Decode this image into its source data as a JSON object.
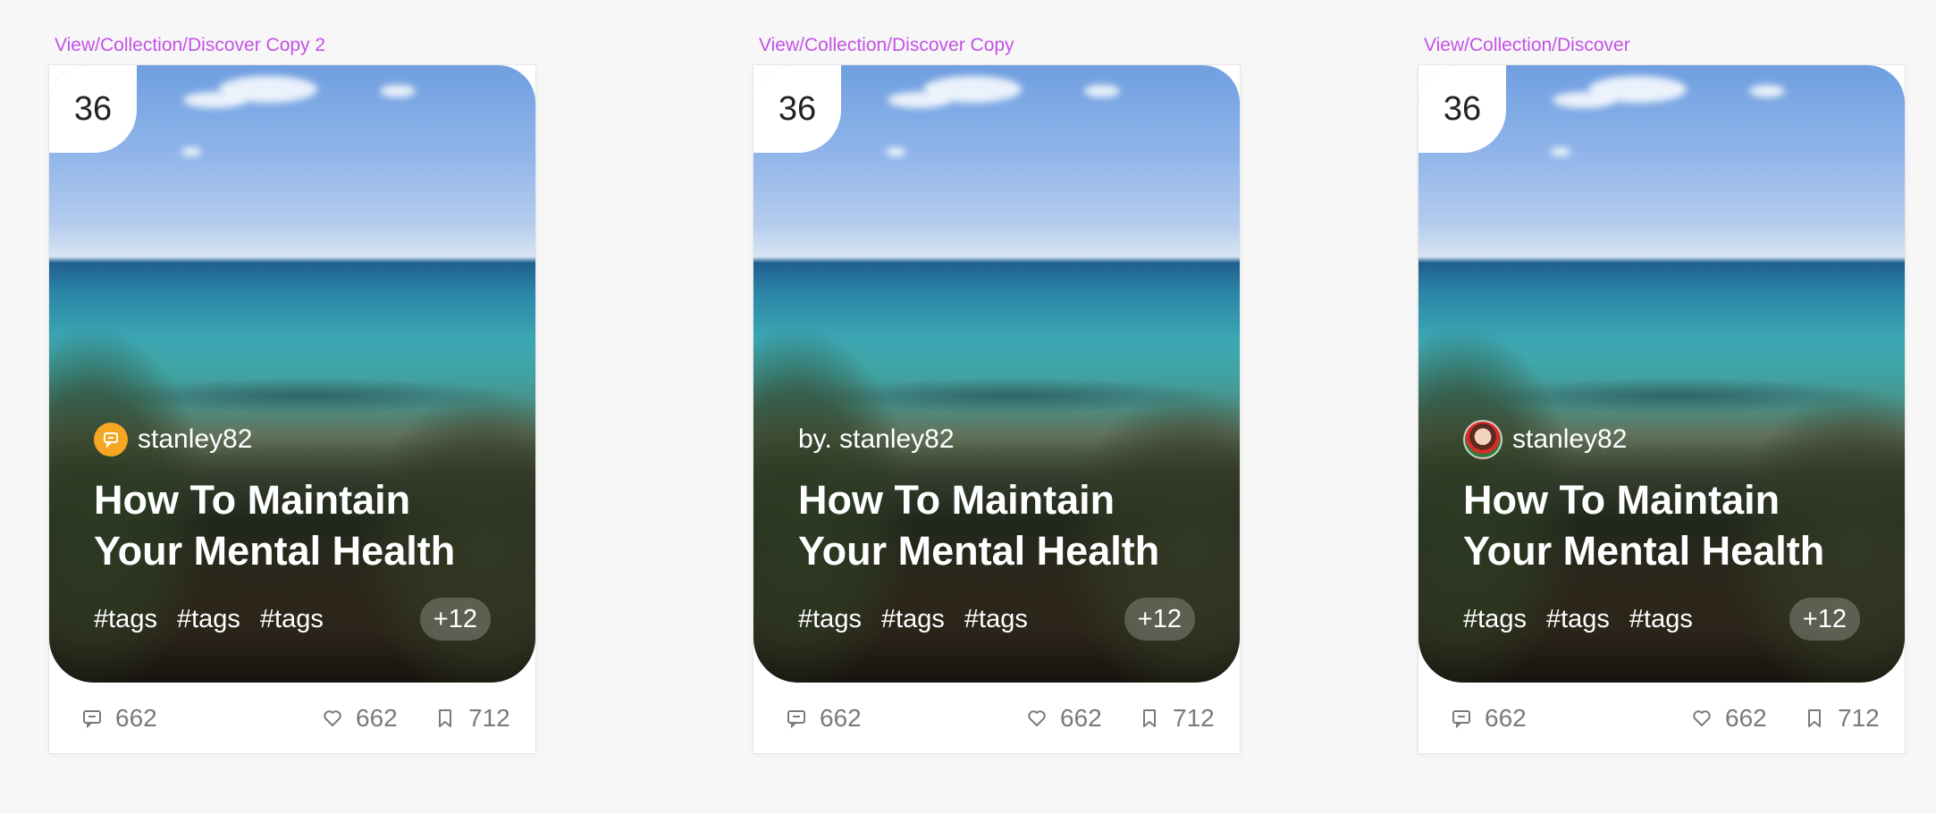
{
  "colors": {
    "label": "#c452e6",
    "author_icon_bg": "#f5a623"
  },
  "frames": [
    {
      "label": "View/Collection/Discover Copy 2",
      "badge": "36",
      "author_style": "icon",
      "author": "stanley82",
      "title_line1": "How To Maintain",
      "title_line2": "Your Mental Health",
      "tags": [
        "#tags",
        "#tags",
        "#tags"
      ],
      "more": "+12",
      "comments": "662",
      "likes": "662",
      "bookmarks": "712"
    },
    {
      "label": "View/Collection/Discover Copy",
      "badge": "36",
      "author_style": "text",
      "author": "by. stanley82",
      "title_line1": "How To Maintain",
      "title_line2": "Your Mental Health",
      "tags": [
        "#tags",
        "#tags",
        "#tags"
      ],
      "more": "+12",
      "comments": "662",
      "likes": "662",
      "bookmarks": "712"
    },
    {
      "label": "View/Collection/Discover",
      "badge": "36",
      "author_style": "avatar",
      "author": "stanley82",
      "title_line1": "How To Maintain",
      "title_line2": "Your Mental Health",
      "tags": [
        "#tags",
        "#tags",
        "#tags"
      ],
      "more": "+12",
      "comments": "662",
      "likes": "662",
      "bookmarks": "712"
    }
  ]
}
